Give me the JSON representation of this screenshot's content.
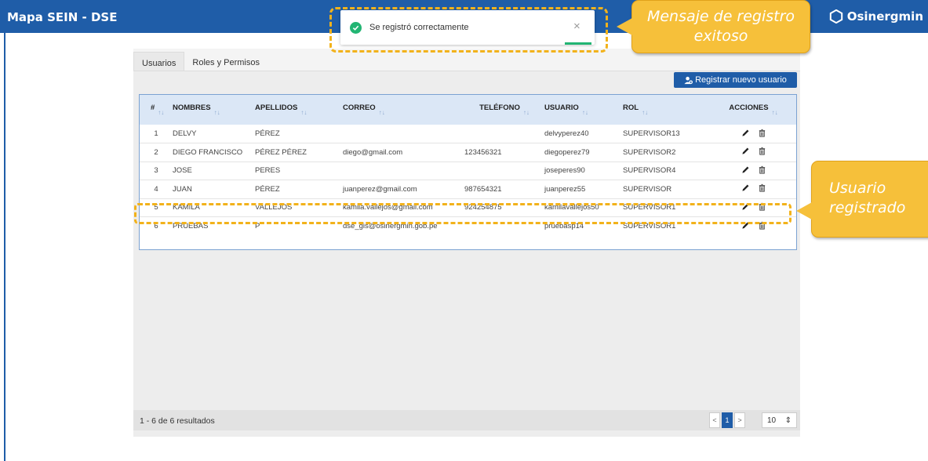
{
  "app_title": "Mapa SEIN - DSE",
  "brand": {
    "name": "Osinergmin",
    "icon": "osinergmin-logo-icon"
  },
  "tabs": [
    {
      "label": "Usuarios",
      "active": true
    },
    {
      "label": "Roles y Permisos",
      "active": false
    }
  ],
  "new_user_button": {
    "label": "Registrar nuevo usuario",
    "icon": "add-user-icon"
  },
  "table": {
    "columns": [
      "#",
      "NOMBRES",
      "APELLIDOS",
      "CORREO",
      "TELÉFONO",
      "USUARIO",
      "ROL",
      "ACCIONES"
    ],
    "sort_indicator": "↑↓",
    "rows": [
      {
        "num": "1",
        "nombres": "DELVY",
        "apellidos": "PÉREZ",
        "correo": "",
        "telefono": "",
        "usuario": "delvyperez40",
        "rol": "SUPERVISOR13"
      },
      {
        "num": "2",
        "nombres": "DIEGO FRANCISCO",
        "apellidos": "PÉREZ PÉREZ",
        "correo": "diego@gmail.com",
        "telefono": "123456321",
        "usuario": "diegoperez79",
        "rol": "SUPERVISOR2"
      },
      {
        "num": "3",
        "nombres": "JOSE",
        "apellidos": "PERES",
        "correo": "",
        "telefono": "",
        "usuario": "joseperes90",
        "rol": "SUPERVISOR4"
      },
      {
        "num": "4",
        "nombres": "JUAN",
        "apellidos": "PÉREZ",
        "correo": "juanperez@gmail.com",
        "telefono": "987654321",
        "usuario": "juanperez55",
        "rol": "SUPERVISOR"
      },
      {
        "num": "5",
        "nombres": "KAMILA",
        "apellidos": "VALLEJOS",
        "correo": "kamila.vallejos@gmail.com",
        "telefono": "924254875",
        "usuario": "kamilavallejos50",
        "rol": "SUPERVISOR1"
      },
      {
        "num": "6",
        "nombres": "PRUEBAS",
        "apellidos": "P",
        "correo": "dse_gis@osinergmin.gob.pe",
        "telefono": "",
        "usuario": "pruebasp14",
        "rol": "SUPERVISOR1"
      }
    ]
  },
  "footer": {
    "results": "1 - 6 de 6 resultados",
    "prev": "<",
    "page": "1",
    "next": ">",
    "page_size": "10",
    "page_size_arrow": "⇕"
  },
  "toast": {
    "message": "Se registró correctamente",
    "close": "×"
  },
  "callouts": {
    "toast_note": "Mensaje de registro exitoso",
    "row_note": "Usuario registrado"
  },
  "colors": {
    "header": "#1f5da8",
    "accent": "#f6c03a",
    "success": "#22b573"
  }
}
